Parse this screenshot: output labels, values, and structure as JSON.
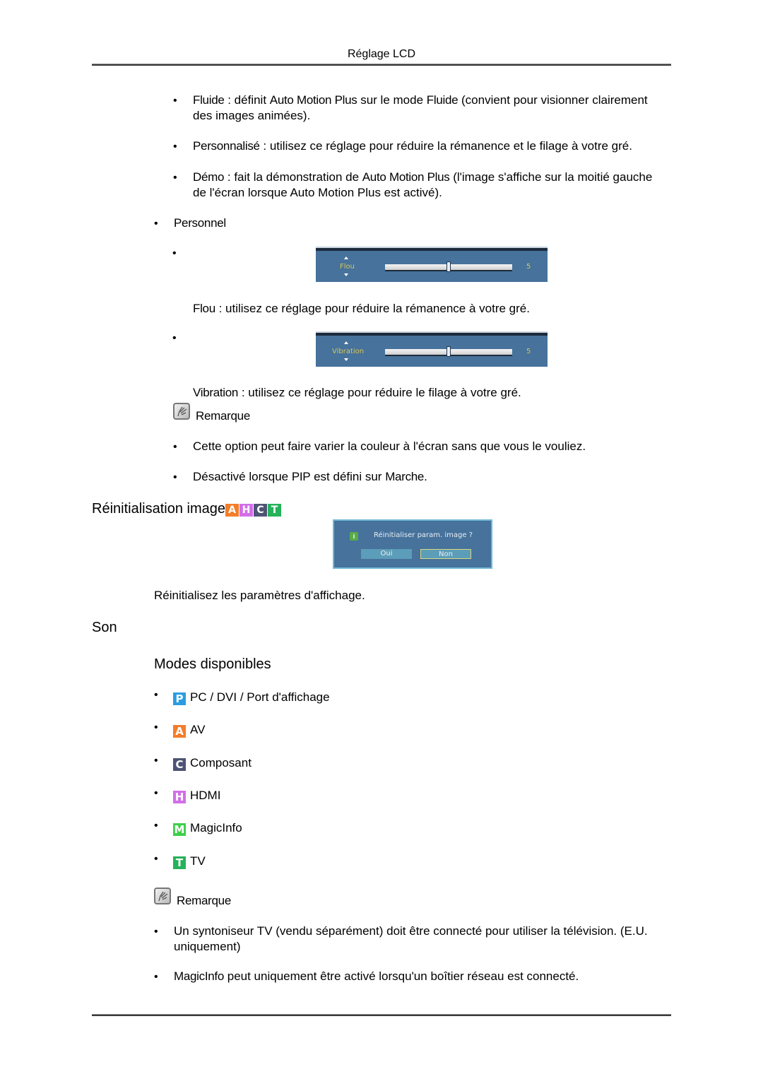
{
  "header": {
    "title": "Réglage LCD"
  },
  "auto_motion_items": [
    {
      "term": "Fluide",
      "sep": " : définit ",
      "term2": "Auto Motion Plus",
      "mid": " sur le mode ",
      "term3": "Fluide",
      "rest": " (convient pour visionner clairement",
      "line2": "des images animées)."
    },
    {
      "term": "Personnalisé",
      "rest": " : utilisez ce réglage pour réduire la rémanence et le filage à votre gré."
    },
    {
      "term": "Démo",
      "sep": " : fait la démonstration de ",
      "term2": "Auto Motion Plus",
      "rest": " (l'image s'affiche sur la moitié gauche",
      "line2": "de l'écran lorsque Auto Motion Plus est activé)."
    }
  ],
  "personnel": {
    "label": "Personnel",
    "bullet": "•",
    "sliders": [
      {
        "label": "Flou",
        "value": "5",
        "fraction": 0.5,
        "desc_term": "Flou",
        "desc_rest": " : utilisez ce réglage pour réduire la rémanence à votre gré."
      },
      {
        "label": "Vibration",
        "value": "5",
        "fraction": 0.5,
        "desc_term": "Vibration",
        "desc_rest": " : utilisez ce réglage pour réduire le filage à votre gré."
      }
    ]
  },
  "note1": {
    "title": "Remarque",
    "items": [
      {
        "text": "Cette option peut faire varier la couleur à l'écran sans que vous le vouliez."
      },
      {
        "pre": "Désactivé lorsque ",
        "term": "PIP",
        "mid": " est défini sur ",
        "term2": "Marche",
        "post": "."
      }
    ]
  },
  "reset_section": {
    "title": "Réinitialisation image",
    "badges": [
      {
        "letter": "A",
        "color": "#f47d2a"
      },
      {
        "letter": "H",
        "color": "#d26ee8"
      },
      {
        "letter": "C",
        "color": "#4d5474"
      },
      {
        "letter": "T",
        "color": "#25b25a"
      }
    ],
    "dialog": {
      "question": "Réinitialiser param. image ?",
      "yes": "Oui",
      "no": "Non",
      "info_icon": "i"
    },
    "description": "Réinitialisez les paramètres d'affichage."
  },
  "son": {
    "title": "Son",
    "subtitle": "Modes disponibles",
    "modes": [
      {
        "letter": "P",
        "color": "#2a9de0",
        "label": "PC / DVI / Port d'affichage"
      },
      {
        "letter": "A",
        "color": "#f47d2a",
        "label": "AV"
      },
      {
        "letter": "C",
        "color": "#4d5474",
        "label": "Composant"
      },
      {
        "letter": "H",
        "color": "#d26ee8",
        "label": "HDMI"
      },
      {
        "letter": "M",
        "color": "#3fcf4a",
        "label": "MagicInfo"
      },
      {
        "letter": "T",
        "color": "#25b25a",
        "label": "TV"
      }
    ]
  },
  "note2": {
    "title": "Remarque",
    "items": [
      {
        "line1": "Un syntoniseur TV (vendu séparément) doit être connecté pour utiliser la télévision. (E.U.",
        "line2": "uniquement)"
      },
      {
        "term": "MagicInfo",
        "rest": " peut uniquement être activé lorsqu'un boîtier réseau est connecté."
      }
    ]
  },
  "bullet_char": "•"
}
